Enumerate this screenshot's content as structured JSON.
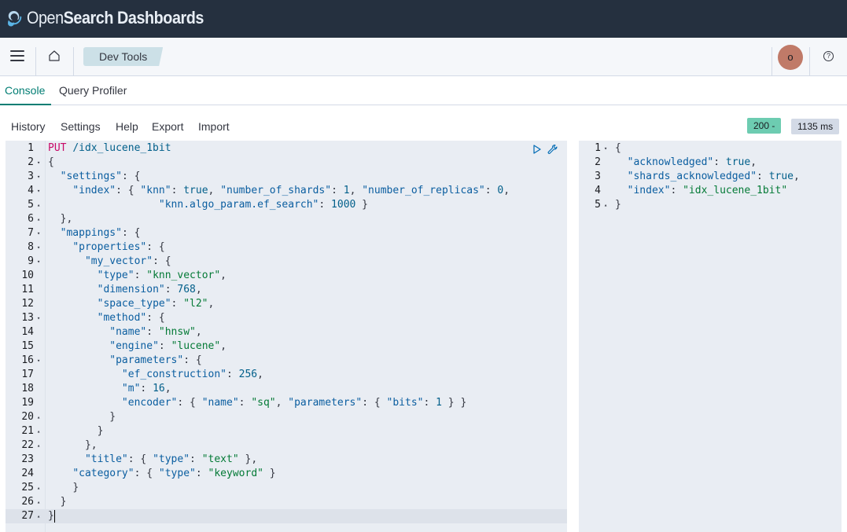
{
  "header": {
    "brand_prefix": "Open",
    "brand_suffix": "Search Dashboards",
    "breadcrumb": "Dev Tools",
    "avatar_initial": "o",
    "help": "?"
  },
  "tabs": [
    {
      "label": "Console",
      "active": true
    },
    {
      "label": "Query Profiler",
      "active": false
    }
  ],
  "menu": [
    "History",
    "Settings",
    "Help",
    "Export",
    "Import"
  ],
  "status": {
    "code": "200 -",
    "time": "1135 ms",
    "color": "#6dccb1"
  },
  "request": {
    "lines": [
      {
        "n": "1",
        "fold": "",
        "html": "<span class='tk-method'>PUT</span> <span class='tk-url'>/idx_lucene_1bit</span>"
      },
      {
        "n": "2",
        "fold": "▾",
        "html": "<span class='tk-p'>{</span>"
      },
      {
        "n": "3",
        "fold": "▾",
        "html": "  <span class='tk-key'>\"settings\"</span><span class='tk-p'>: {</span>"
      },
      {
        "n": "4",
        "fold": "▾",
        "html": "    <span class='tk-key'>\"index\"</span><span class='tk-p'>: { </span><span class='tk-key'>\"knn\"</span><span class='tk-p'>: </span><span class='tk-bool'>true</span><span class='tk-p'>, </span><span class='tk-key'>\"number_of_shards\"</span><span class='tk-p'>: </span><span class='tk-num'>1</span><span class='tk-p'>, </span><span class='tk-key'>\"number_of_replicas\"</span><span class='tk-p'>: </span><span class='tk-num'>0</span><span class='tk-p'>,</span>"
      },
      {
        "n": "5",
        "fold": "▴",
        "html": "                  <span class='tk-key'>\"knn.algo_param.ef_search\"</span><span class='tk-p'>: </span><span class='tk-num'>1000</span><span class='tk-p'> }</span>"
      },
      {
        "n": "6",
        "fold": "▴",
        "html": "  <span class='tk-p'>},</span>"
      },
      {
        "n": "7",
        "fold": "▾",
        "html": "  <span class='tk-key'>\"mappings\"</span><span class='tk-p'>: {</span>"
      },
      {
        "n": "8",
        "fold": "▾",
        "html": "    <span class='tk-key'>\"properties\"</span><span class='tk-p'>: {</span>"
      },
      {
        "n": "9",
        "fold": "▾",
        "html": "      <span class='tk-key'>\"my_vector\"</span><span class='tk-p'>: {</span>"
      },
      {
        "n": "10",
        "fold": "",
        "html": "        <span class='tk-key'>\"type\"</span><span class='tk-p'>: </span><span class='tk-str'>\"knn_vector\"</span><span class='tk-p'>,</span>"
      },
      {
        "n": "11",
        "fold": "",
        "html": "        <span class='tk-key'>\"dimension\"</span><span class='tk-p'>: </span><span class='tk-num'>768</span><span class='tk-p'>,</span>"
      },
      {
        "n": "12",
        "fold": "",
        "html": "        <span class='tk-key'>\"space_type\"</span><span class='tk-p'>: </span><span class='tk-str'>\"l2\"</span><span class='tk-p'>,</span>"
      },
      {
        "n": "13",
        "fold": "▾",
        "html": "        <span class='tk-key'>\"method\"</span><span class='tk-p'>: {</span>"
      },
      {
        "n": "14",
        "fold": "",
        "html": "          <span class='tk-key'>\"name\"</span><span class='tk-p'>: </span><span class='tk-str'>\"hnsw\"</span><span class='tk-p'>,</span>"
      },
      {
        "n": "15",
        "fold": "",
        "html": "          <span class='tk-key'>\"engine\"</span><span class='tk-p'>: </span><span class='tk-str'>\"lucene\"</span><span class='tk-p'>,</span>"
      },
      {
        "n": "16",
        "fold": "▾",
        "html": "          <span class='tk-key'>\"parameters\"</span><span class='tk-p'>: {</span>"
      },
      {
        "n": "17",
        "fold": "",
        "html": "            <span class='tk-key'>\"ef_construction\"</span><span class='tk-p'>: </span><span class='tk-num'>256</span><span class='tk-p'>,</span>"
      },
      {
        "n": "18",
        "fold": "",
        "html": "            <span class='tk-key'>\"m\"</span><span class='tk-p'>: </span><span class='tk-num'>16</span><span class='tk-p'>,</span>"
      },
      {
        "n": "19",
        "fold": "",
        "html": "            <span class='tk-key'>\"encoder\"</span><span class='tk-p'>: { </span><span class='tk-key'>\"name\"</span><span class='tk-p'>: </span><span class='tk-str'>\"sq\"</span><span class='tk-p'>, </span><span class='tk-key'>\"parameters\"</span><span class='tk-p'>: { </span><span class='tk-key'>\"bits\"</span><span class='tk-p'>: </span><span class='tk-num'>1</span><span class='tk-p'> } }</span>"
      },
      {
        "n": "20",
        "fold": "▴",
        "html": "          <span class='tk-p'>}</span>"
      },
      {
        "n": "21",
        "fold": "▴",
        "html": "        <span class='tk-p'>}</span>"
      },
      {
        "n": "22",
        "fold": "▴",
        "html": "      <span class='tk-p'>},</span>"
      },
      {
        "n": "23",
        "fold": "",
        "html": "      <span class='tk-key'>\"title\"</span><span class='tk-p'>: { </span><span class='tk-key'>\"type\"</span><span class='tk-p'>: </span><span class='tk-str'>\"text\"</span><span class='tk-p'> },</span>"
      },
      {
        "n": "24",
        "fold": "",
        "html": "    <span class='tk-key'>\"category\"</span><span class='tk-p'>: { </span><span class='tk-key'>\"type\"</span><span class='tk-p'>: </span><span class='tk-str'>\"keyword\"</span><span class='tk-p'> }</span>"
      },
      {
        "n": "25",
        "fold": "▴",
        "html": "    <span class='tk-p'>}</span>"
      },
      {
        "n": "26",
        "fold": "▴",
        "html": "  <span class='tk-p'>}</span>"
      },
      {
        "n": "27",
        "fold": "▴",
        "html": "<span class='tk-p'>}</span>"
      }
    ]
  },
  "response": {
    "lines": [
      {
        "n": "1",
        "fold": "▾",
        "html": "<span class='tk-p'>{</span>"
      },
      {
        "n": "2",
        "fold": "",
        "html": "  <span class='tk-key'>\"acknowledged\"</span><span class='tk-p'>: </span><span class='tk-bool'>true</span><span class='tk-p'>,</span>"
      },
      {
        "n": "3",
        "fold": "",
        "html": "  <span class='tk-key'>\"shards_acknowledged\"</span><span class='tk-p'>: </span><span class='tk-bool'>true</span><span class='tk-p'>,</span>"
      },
      {
        "n": "4",
        "fold": "",
        "html": "  <span class='tk-key'>\"index\"</span><span class='tk-p'>: </span><span class='tk-str'>\"idx_lucene_1bit\"</span>"
      },
      {
        "n": "5",
        "fold": "▴",
        "html": "<span class='tk-p'>}</span>"
      }
    ]
  }
}
